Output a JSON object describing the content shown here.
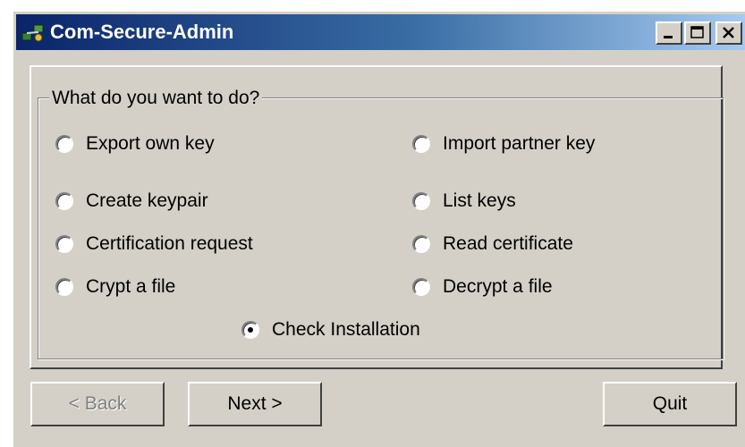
{
  "window": {
    "title": "Com-Secure-Admin"
  },
  "titlebar_buttons": {
    "minimize": "minimize",
    "maximize": "maximize",
    "close": "close"
  },
  "group": {
    "label": "What do you want to do?"
  },
  "options": {
    "export_own_key": "Export own key",
    "import_partner_key": "Import partner key",
    "create_keypair": "Create keypair",
    "list_keys": "List keys",
    "certification_request": "Certification request",
    "read_certificate": "Read certificate",
    "crypt_file": "Crypt a file",
    "decrypt_file": "Decrypt a file",
    "check_installation": "Check Installation",
    "selected": "Check Installation"
  },
  "buttons": {
    "back": "< Back",
    "next": "Next >",
    "quit": "Quit"
  },
  "colors": {
    "face": "#d4d0c8",
    "title_start": "#0a246a",
    "title_end": "#a6caf0",
    "disabled_text": "#808080"
  }
}
